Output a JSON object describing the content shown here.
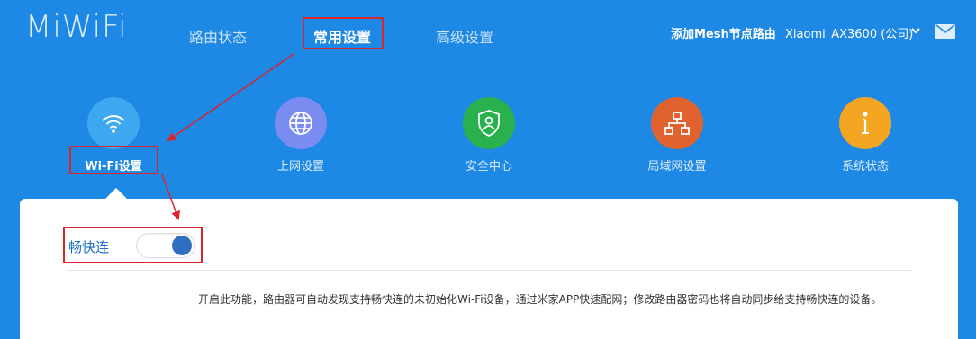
{
  "header": {
    "logo": "MiWiFi",
    "nav": [
      {
        "label": "路由状态"
      },
      {
        "label": "常用设置"
      },
      {
        "label": "高级设置"
      }
    ],
    "mesh_link": "添加Mesh节点路由",
    "device_name": "Xiaomi_AX3600 (公司)"
  },
  "categories": [
    {
      "label": "Wi-Fi设置",
      "icon": "wifi-icon",
      "color": "#3da8f0"
    },
    {
      "label": "上网设置",
      "icon": "globe-icon",
      "color": "#7a8cf0"
    },
    {
      "label": "安全中心",
      "icon": "shield-icon",
      "color": "#28b14c"
    },
    {
      "label": "局域网设置",
      "icon": "network-icon",
      "color": "#e0632f"
    },
    {
      "label": "系统状态",
      "icon": "info-icon",
      "color": "#f4a623"
    }
  ],
  "panel": {
    "toggle_label": "畅快连",
    "toggle_on": true,
    "description": "开启此功能，路由器可自动发现支持畅快连的未初始化Wi-Fi设备，通过米家APP快速配网；修改路由器密码也将自动同步给支持畅快连的设备。"
  },
  "colors": {
    "background": "#1e88e5",
    "annotation_red": "#d9252b",
    "toggle_accent": "#2e6fc0"
  }
}
